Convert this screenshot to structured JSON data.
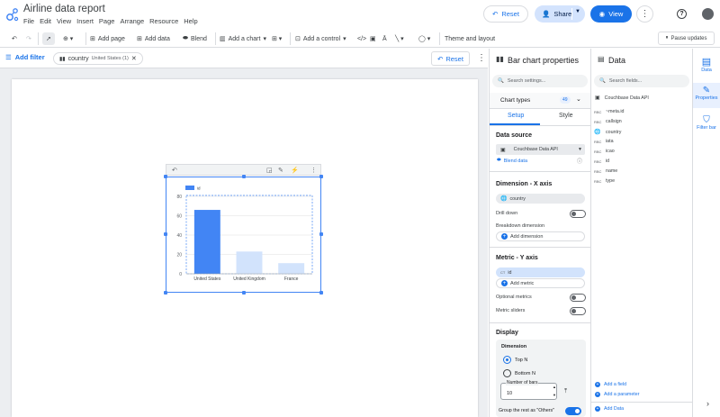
{
  "app": {
    "title": "Airline data report",
    "menu": [
      "File",
      "Edit",
      "View",
      "Insert",
      "Page",
      "Arrange",
      "Resource",
      "Help"
    ],
    "reset_label": "Reset",
    "share_label": "Share",
    "view_label": "View"
  },
  "toolbar": {
    "add_page": "Add page",
    "add_data": "Add data",
    "blend": "Blend",
    "add_chart": "Add a chart",
    "add_control": "Add a control",
    "theme_layout": "Theme and layout",
    "pause_updates": "Pause updates"
  },
  "filterbar": {
    "add_filter": "Add filter",
    "chip_field": "country",
    "chip_value": "United States (1)",
    "reset_label": "Reset"
  },
  "chart_data": {
    "type": "bar",
    "categories": [
      "United States",
      "United Kingdom",
      "France"
    ],
    "series": [
      {
        "name": "id",
        "values": [
          66,
          23,
          11
        ]
      }
    ],
    "ylim": [
      0,
      80
    ],
    "yticks": [
      "0",
      "20",
      "40",
      "60",
      "80"
    ],
    "xlabel": "",
    "ylabel": "",
    "legend_placement": "top-left",
    "selected_category": "United States",
    "colors": {
      "selected": "#4285f4",
      "dimmed": "#d2e3fc"
    }
  },
  "properties": {
    "title": "Bar chart properties",
    "search_placeholder": "Search settings...",
    "chart_types_label": "Chart types",
    "chart_types_count": "49",
    "tab_setup": "Setup",
    "tab_style": "Style",
    "data_source_title": "Data source",
    "data_source_name": "Couchbase Data API",
    "blend_data": "Blend data",
    "dimension_title": "Dimension - X axis",
    "dimension_field": "country",
    "drill_down": "Drill down",
    "breakdown_dimension": "Breakdown dimension",
    "add_dimension": "Add dimension",
    "metric_title": "Metric - Y axis",
    "metric_field": "id",
    "metric_prefix": "CT",
    "add_metric": "Add metric",
    "optional_metrics": "Optional metrics",
    "metric_sliders": "Metric sliders",
    "display_title": "Display",
    "dimension_sub": "Dimension",
    "top_n": "Top N",
    "bottom_n": "Bottom N",
    "number_of_bars_label": "Number of bars",
    "number_of_bars_value": "10",
    "group_rest": "Group the rest as \"Others\""
  },
  "data_panel": {
    "title": "Data",
    "search_placeholder": "Search fields...",
    "source_name": "Couchbase Data API",
    "fields": [
      {
        "type": "RBC",
        "name": "~meta.id"
      },
      {
        "type": "RBC",
        "name": "callsign"
      },
      {
        "type": "globe",
        "name": "country"
      },
      {
        "type": "RBC",
        "name": "iata"
      },
      {
        "type": "RBC",
        "name": "icao"
      },
      {
        "type": "RBC",
        "name": "id"
      },
      {
        "type": "RBC",
        "name": "name"
      },
      {
        "type": "RBC",
        "name": "type"
      }
    ],
    "add_field": "Add a field",
    "add_parameter": "Add a parameter",
    "add_data": "Add Data"
  },
  "rail": {
    "data": "Data",
    "properties": "Properties",
    "filter_bar": "Filter bar"
  },
  "colors": {
    "accent": "#1a73e8",
    "bar": "#4285f4"
  }
}
